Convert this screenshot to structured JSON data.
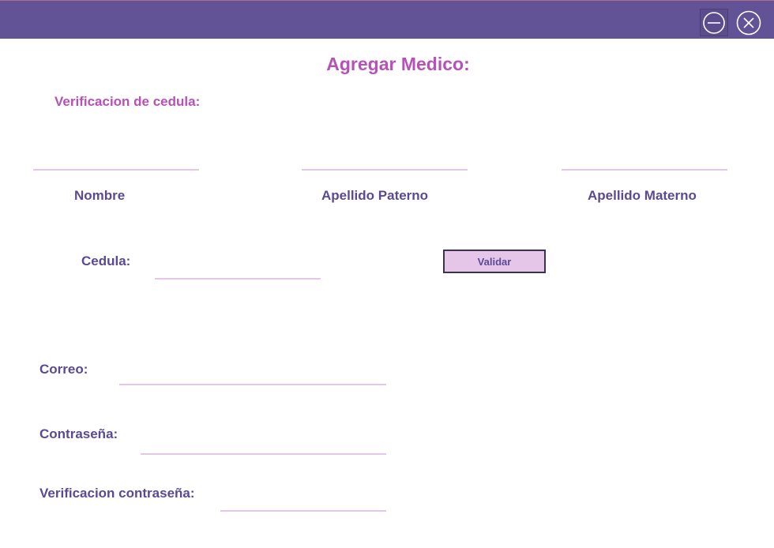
{
  "window": {
    "minimize_icon": "minus-circle-icon",
    "close_icon": "x-circle-icon",
    "colors": {
      "titlebar": "#625396",
      "heading": "#b750b7",
      "label": "#5a4a94",
      "underline": "#e6c6e8",
      "button_bg": "#e6c6e8"
    }
  },
  "form": {
    "title": "Agregar Medico:",
    "subtitle": "Verificacion de cedula:",
    "labels": {
      "nombre": "Nombre",
      "apellido_paterno": "Apellido Paterno",
      "apellido_materno": "Apellido Materno",
      "cedula": "Cedula:",
      "correo": "Correo:",
      "contrasena": "Contraseña:",
      "verificacion_contrasena": "Verificacion contraseña:"
    },
    "values": {
      "nombre": "",
      "apellido_paterno": "",
      "apellido_materno": "",
      "cedula": "",
      "correo": "",
      "contrasena": "",
      "verificacion_contrasena": ""
    },
    "validate_button": "Validar"
  }
}
